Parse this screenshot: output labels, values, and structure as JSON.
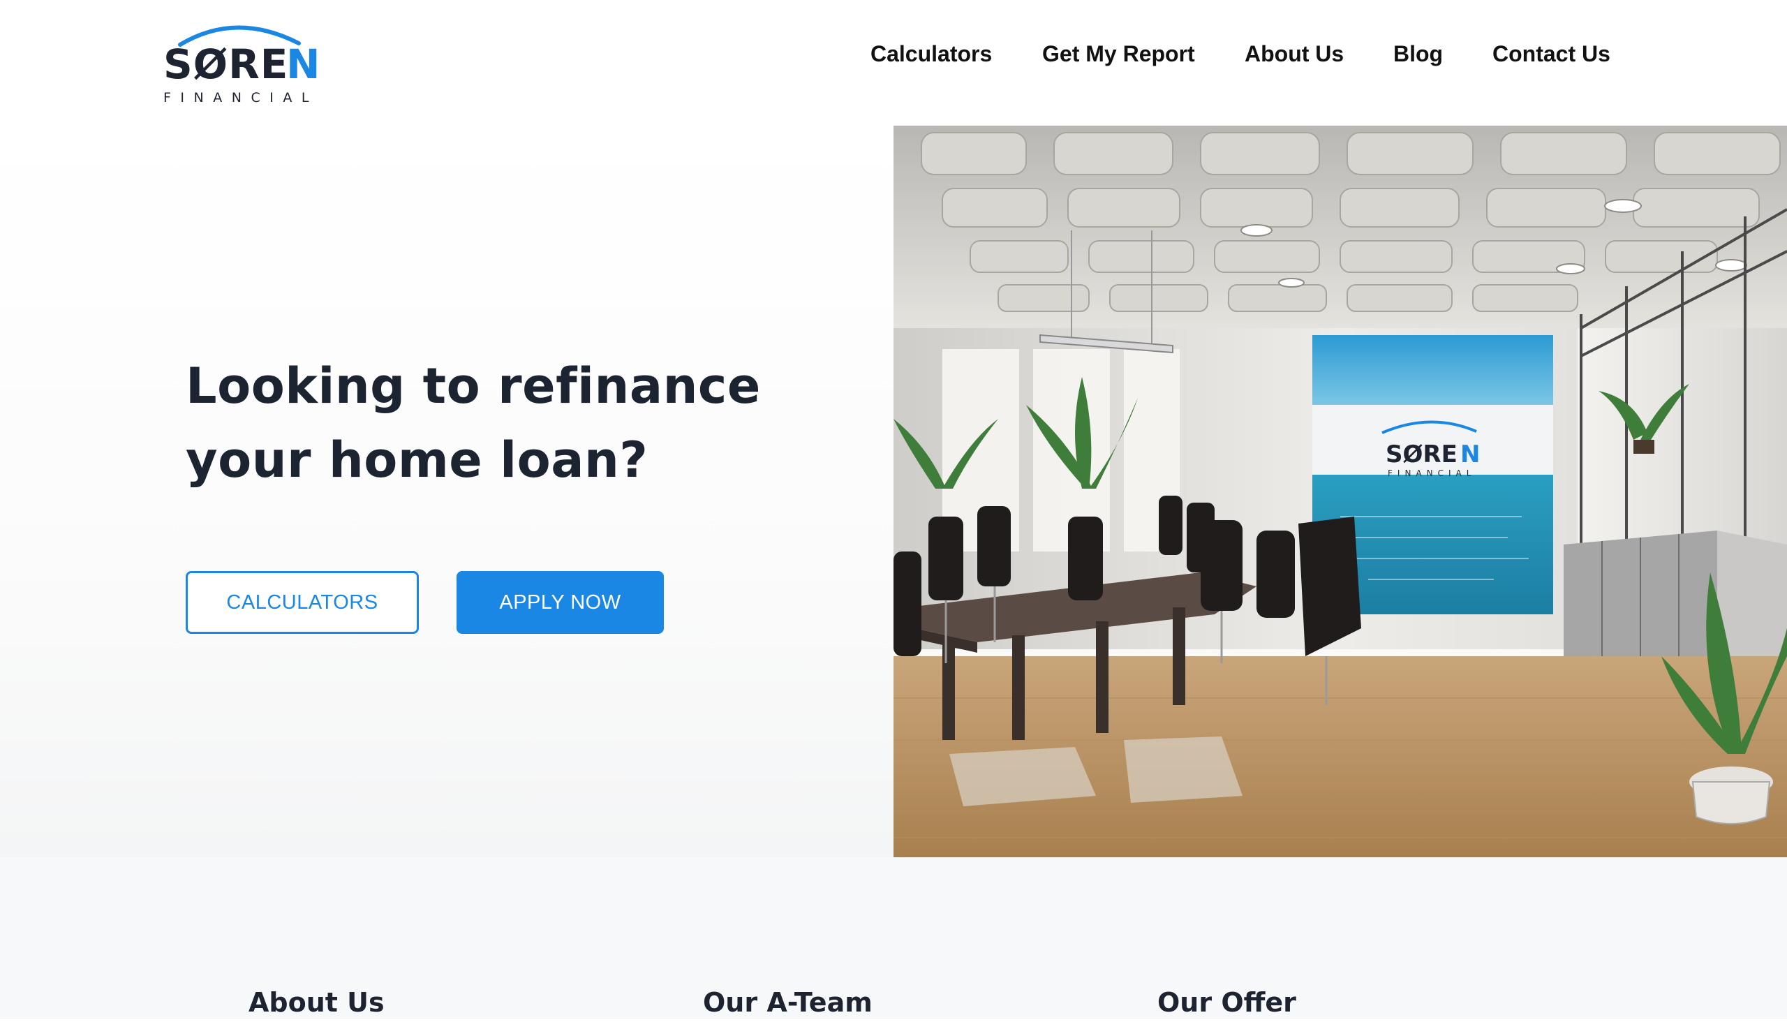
{
  "brand": {
    "name": "SØREN",
    "tagline": "FINANCIAL",
    "accent_color": "#1a87e5",
    "text_color": "#1d2330"
  },
  "nav": {
    "items": [
      {
        "label": "Calculators"
      },
      {
        "label": "Get My Report"
      },
      {
        "label": "About Us"
      },
      {
        "label": "Blog"
      },
      {
        "label": "Contact Us"
      }
    ]
  },
  "hero": {
    "title_line1": "Looking to refinance",
    "title_line2": "your home loan?",
    "primary_button": "APPLY NOW",
    "secondary_button": "CALCULATORS",
    "image_icon": "office-boardroom-image"
  },
  "sections": {
    "headings": [
      {
        "label": "About Us"
      },
      {
        "label": "Our A-Team"
      },
      {
        "label": "Our Offer"
      }
    ]
  }
}
